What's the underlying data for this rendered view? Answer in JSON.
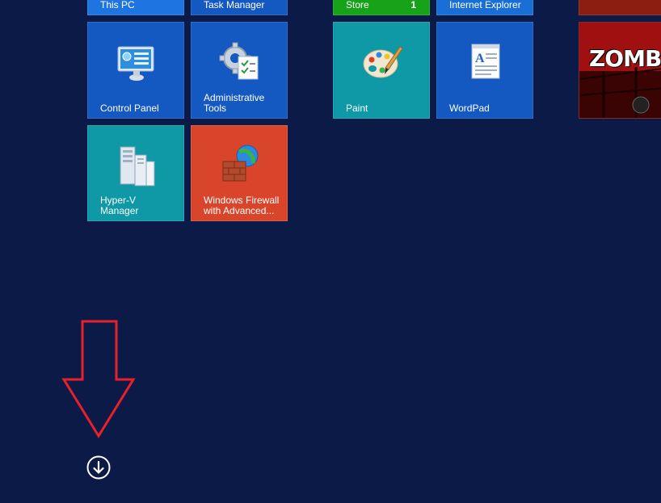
{
  "tiles": {
    "this_pc": {
      "label": "This PC",
      "color": "#1e74e0"
    },
    "task_manager": {
      "label": "Task Manager",
      "color": "#1458c2"
    },
    "store": {
      "label": "Store",
      "badge": "1",
      "color": "#16a31a"
    },
    "internet_explorer": {
      "label": "Internet Explorer",
      "color": "#1a6fd6"
    },
    "control_panel": {
      "label": "Control Panel",
      "color": "#1458c2"
    },
    "administrative_tools": {
      "label": "Administrative\nTools",
      "color": "#1458c2"
    },
    "paint": {
      "label": "Paint",
      "color": "#0f98a6"
    },
    "wordpad": {
      "label": "WordPad",
      "color": "#1458c2"
    },
    "zombie_game": {
      "logo_text": "ZOMBI",
      "color": "#a01010"
    },
    "hyperv_manager": {
      "label": "Hyper-V\nManager",
      "color": "#0f98a6"
    },
    "windows_firewall": {
      "label": "Windows Firewall\nwith Advanced...",
      "color": "#d8452a"
    }
  },
  "annotation": {
    "arrow_color": "#e8202a"
  },
  "apps_button": {
    "icon": "down-arrow-circle-icon"
  }
}
